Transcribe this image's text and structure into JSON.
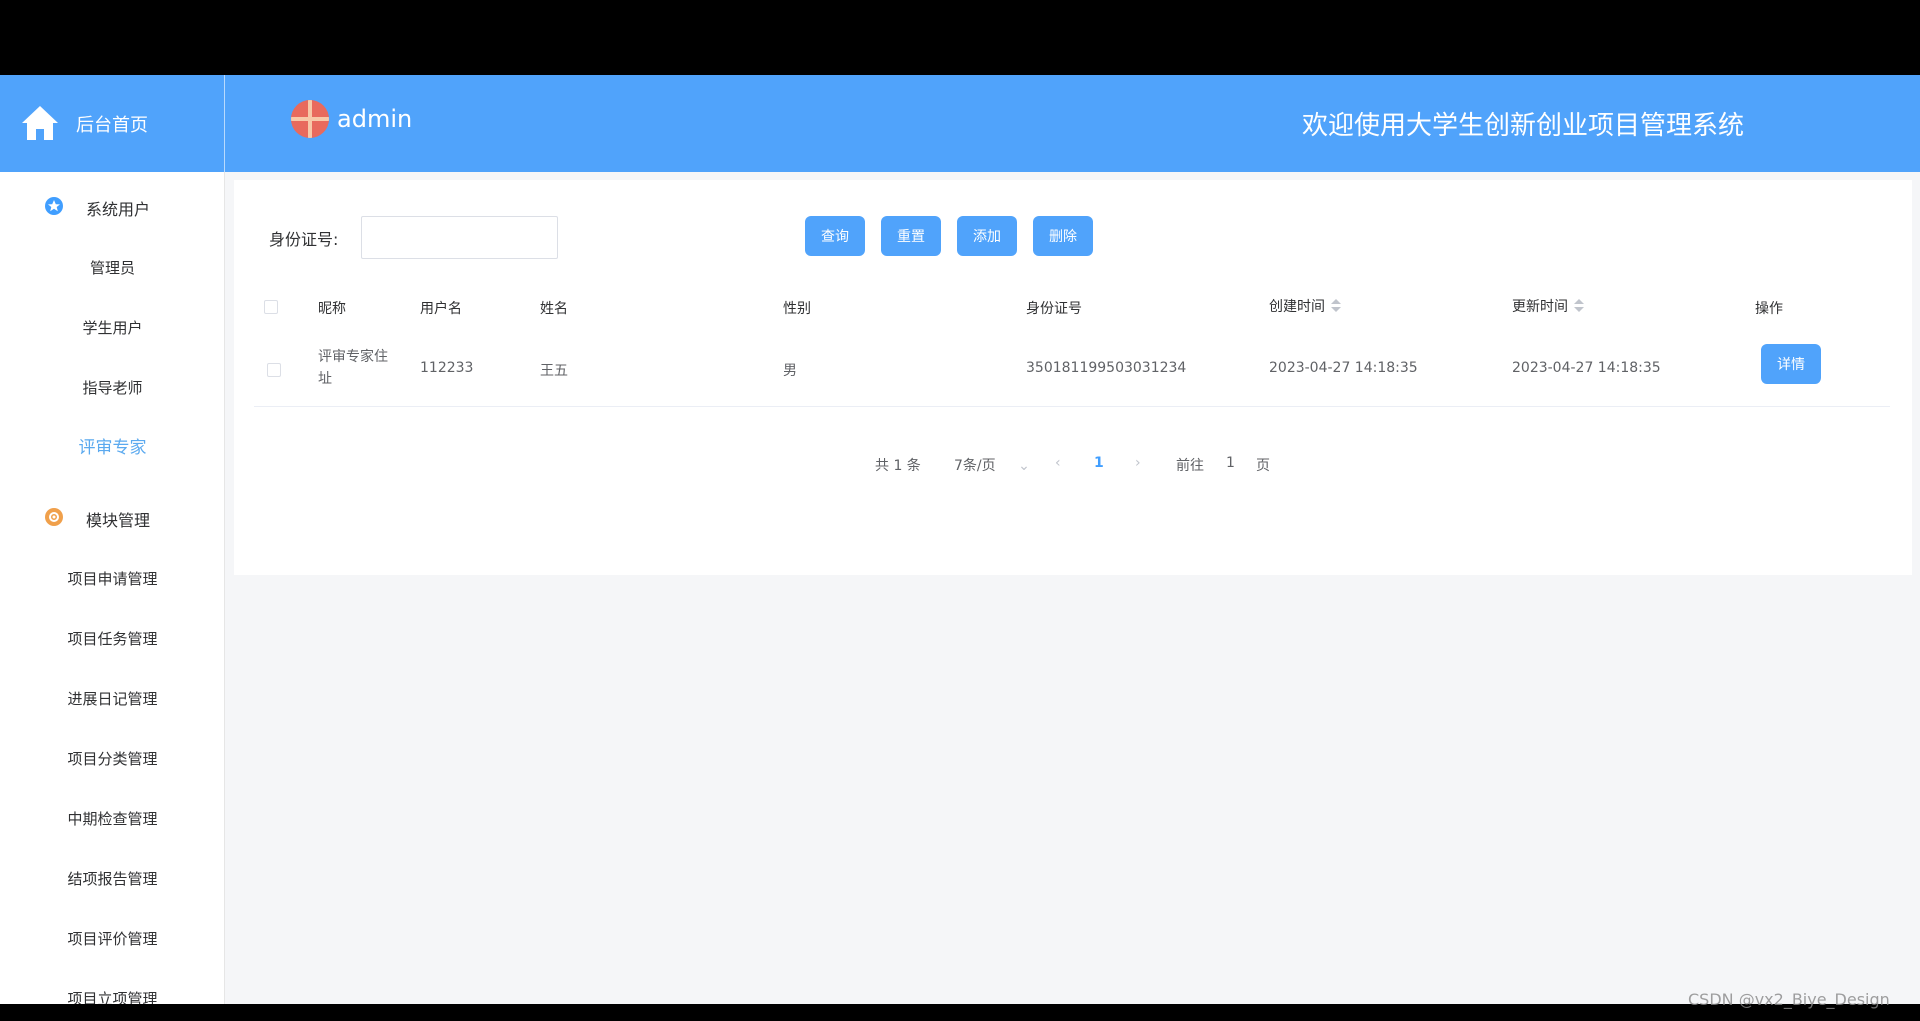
{
  "header": {
    "home_label": "后台首页",
    "user_name": "admin",
    "welcome": "欢迎使用大学生创新创业项目管理系统"
  },
  "sidebar": {
    "groups": [
      {
        "label": "系统用户",
        "icon": "star-badge-icon",
        "color": "#409eff"
      },
      {
        "label": "模块管理",
        "icon": "gear-badge-icon",
        "color": "#f0a04b"
      }
    ],
    "items": [
      {
        "label": "管理员"
      },
      {
        "label": "学生用户"
      },
      {
        "label": "指导老师"
      },
      {
        "label": "评审专家",
        "active": true
      },
      {
        "label": "项目申请管理"
      },
      {
        "label": "项目任务管理"
      },
      {
        "label": "进展日记管理"
      },
      {
        "label": "项目分类管理"
      },
      {
        "label": "中期检查管理"
      },
      {
        "label": "结项报告管理"
      },
      {
        "label": "项目评价管理"
      },
      {
        "label": "项目立项管理"
      }
    ]
  },
  "search": {
    "label": "身份证号:",
    "value": "",
    "placeholder": ""
  },
  "buttons": {
    "query": "查询",
    "reset": "重置",
    "add": "添加",
    "delete": "删除",
    "detail": "详情"
  },
  "table": {
    "columns": [
      "昵称",
      "用户名",
      "姓名",
      "性别",
      "身份证号",
      "创建时间",
      "更新时间",
      "操作"
    ],
    "rows": [
      {
        "nickname_line1": "评审专家住",
        "nickname_line2": "址",
        "username": "112233",
        "name": "王五",
        "gender": "男",
        "id_number": "350181199503031234",
        "created": "2023-04-27 14:18:35",
        "updated": "2023-04-27 14:18:35"
      }
    ]
  },
  "pagination": {
    "total": "共 1 条",
    "page_size": "7条/页",
    "current_page": "1",
    "goto_label": "前往",
    "goto_value": "1",
    "page_suffix": "页"
  },
  "watermark": "CSDN @vx2_Biye_Design",
  "colors": {
    "primary": "#50a3fb",
    "active_menu": "#5aa9ef"
  }
}
